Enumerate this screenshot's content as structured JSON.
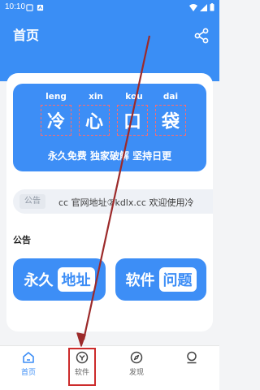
{
  "status_bar": {
    "time": "10:10"
  },
  "header": {
    "title": "首页"
  },
  "banner": {
    "pinyin": [
      "leng",
      "xin",
      "kou",
      "dai"
    ],
    "characters": [
      "冷",
      "心",
      "口",
      "袋"
    ],
    "slogan": "永久免费 独家破解 坚持日更"
  },
  "notice": {
    "badge": "公告",
    "text": "cc 官网地址②kdlx.cc   欢迎使用冷"
  },
  "section": {
    "title": "公告"
  },
  "buttons": {
    "address": {
      "plain": "永久",
      "boxed": "地址"
    },
    "problem": {
      "plain": "软件",
      "boxed": "问题"
    }
  },
  "tabs": [
    {
      "label": "首页",
      "icon": "home-icon",
      "active": true
    },
    {
      "label": "软件",
      "icon": "software-icon",
      "active": false
    },
    {
      "label": "发现",
      "icon": "compass-icon",
      "active": false
    },
    {
      "label": "",
      "icon": "profile-icon",
      "active": false
    }
  ],
  "colors": {
    "primary": "#3d8ef6",
    "annotation": "#cc2b2b",
    "background": "#f3f4f6"
  }
}
